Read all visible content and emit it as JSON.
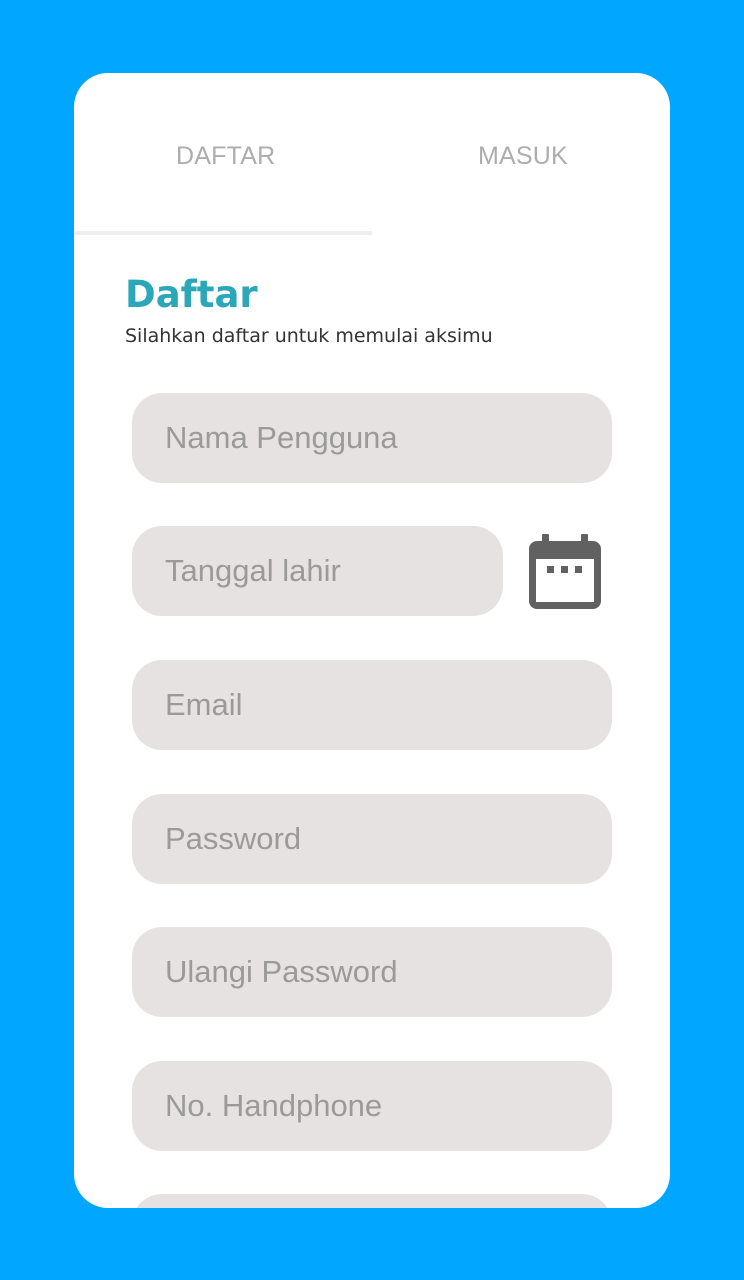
{
  "tabs": {
    "daftar_label": "DAFTAR",
    "masuk_label": "MASUK"
  },
  "form": {
    "title": "Daftar",
    "subtitle": "Silahkan daftar untuk memulai aksimu",
    "fields": {
      "nama_placeholder": "Nama Pengguna",
      "tanggal_placeholder": "Tanggal lahir",
      "email_placeholder": "Email",
      "password_placeholder": "Password",
      "ulangi_placeholder": "Ulangi Password",
      "hp_placeholder": "No. Handphone"
    },
    "calendar_icon": "calendar-icon"
  },
  "colors": {
    "background": "#00A6FF",
    "card": "#FFFFFF",
    "title": "#2AA7B8",
    "field_bg": "#E7E2E2",
    "tab_text": "#ADADAD",
    "icon": "#616161"
  }
}
